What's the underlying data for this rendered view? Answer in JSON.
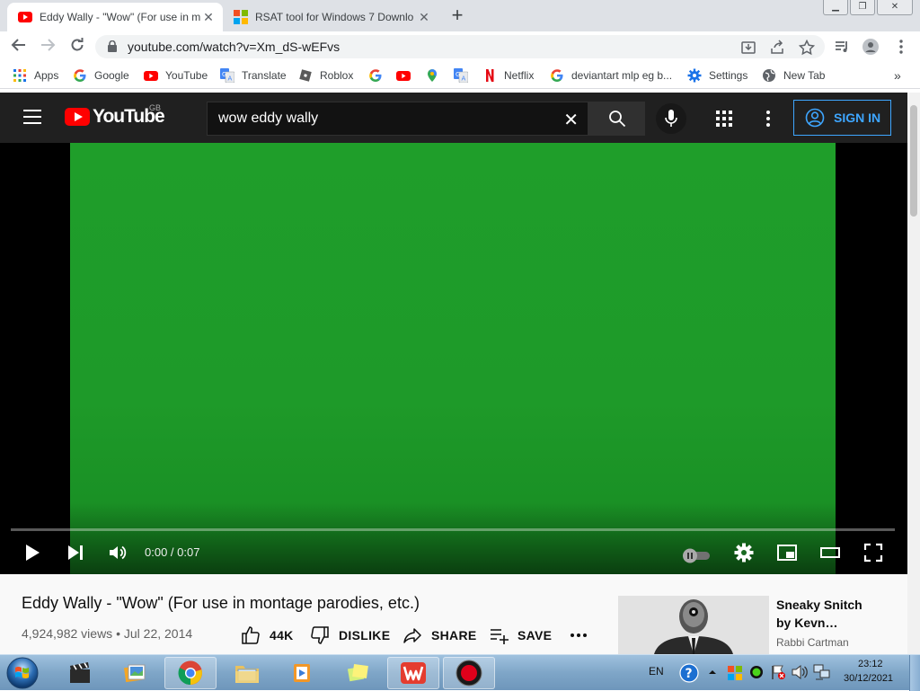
{
  "browser": {
    "tabs": [
      {
        "title": "Eddy Wally - \"Wow\" (For use in m",
        "active": true
      },
      {
        "title": "RSAT tool for Windows 7 Downlo",
        "active": false
      }
    ],
    "url": "youtube.com/watch?v=Xm_dS-wEFvs",
    "bookmarks": [
      {
        "label": "Apps",
        "icon": "apps-grid-icon"
      },
      {
        "label": "Google",
        "icon": "google-icon"
      },
      {
        "label": "YouTube",
        "icon": "youtube-icon"
      },
      {
        "label": "Translate",
        "icon": "translate-icon"
      },
      {
        "label": "Roblox",
        "icon": "roblox-icon"
      },
      {
        "label": "",
        "icon": "google-icon"
      },
      {
        "label": "",
        "icon": "youtube-icon"
      },
      {
        "label": "",
        "icon": "maps-icon"
      },
      {
        "label": "",
        "icon": "translate-icon"
      },
      {
        "label": "Netflix",
        "icon": "netflix-icon"
      },
      {
        "label": "deviantart mlp eg b...",
        "icon": "google-icon"
      },
      {
        "label": "Settings",
        "icon": "gear-icon"
      },
      {
        "label": "New Tab",
        "icon": "globe-icon"
      }
    ],
    "more_bookmarks": "»"
  },
  "youtube": {
    "logo_text": "YouTube",
    "region": "GB",
    "search_query": "wow eddy wally",
    "sign_in": "SIGN IN"
  },
  "player": {
    "time": "0:00 / 0:07",
    "progress": 0.0
  },
  "video": {
    "title": "Eddy Wally - \"Wow\" (For use in montage parodies, etc.)",
    "views": "4,924,982 views",
    "date": "Jul 22, 2014",
    "likes": "44K",
    "dislike": "DISLIKE",
    "share": "SHARE",
    "save": "SAVE"
  },
  "suggestion": {
    "title_line1": "Sneaky Snitch",
    "title_line2": "by Kevn…",
    "channel": "Rabbi Cartman"
  },
  "taskbar": {
    "lang": "EN",
    "time": "23:12",
    "date": "30/12/2021"
  }
}
